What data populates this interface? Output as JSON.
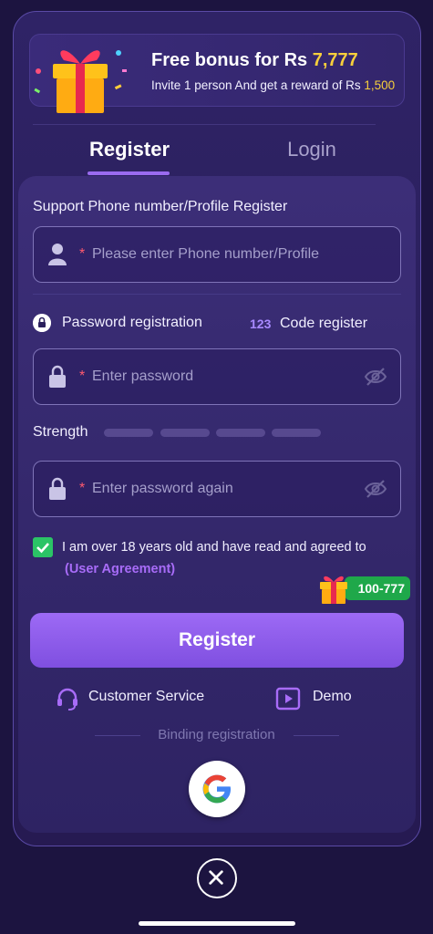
{
  "bonus": {
    "title_prefix": "Free bonus for Rs ",
    "title_amount": "7,777",
    "subtitle_prefix": "Invite 1 person And get a reward of Rs ",
    "subtitle_amount": "1,500"
  },
  "tabs": [
    {
      "label": "Register",
      "active": true
    },
    {
      "label": "Login",
      "active": false
    }
  ],
  "form": {
    "phone_label": "Support Phone number/Profile Register",
    "phone_placeholder": "Please enter Phone number/Profile",
    "required_mark": "*",
    "password_mode_label": "Password registration",
    "code_mode_number": "123",
    "code_mode_label": "Code register",
    "password_placeholder": "Enter password",
    "strength_label": "Strength",
    "strength_level": 0,
    "confirm_placeholder": "Enter password again",
    "agree_checked": true,
    "agree_text": "I am over 18 years old and have read and agreed to",
    "agree_link": "(User Agreement)",
    "promo_badge": "100-777",
    "submit_label": "Register"
  },
  "links": {
    "customer_service": "Customer Service",
    "demo": "Demo"
  },
  "binding": {
    "label": "Binding registration"
  },
  "icons": [
    "gift-icon",
    "user-icon",
    "lock-icon",
    "eye-off-icon",
    "checkbox-icon",
    "headset-icon",
    "play-icon",
    "google-icon",
    "close-icon"
  ],
  "colors": {
    "accent": "#9a6bf0",
    "gold": "#f7cf3c",
    "required": "#ff5a6e",
    "success": "#2bc466",
    "link": "#a86cf8"
  }
}
